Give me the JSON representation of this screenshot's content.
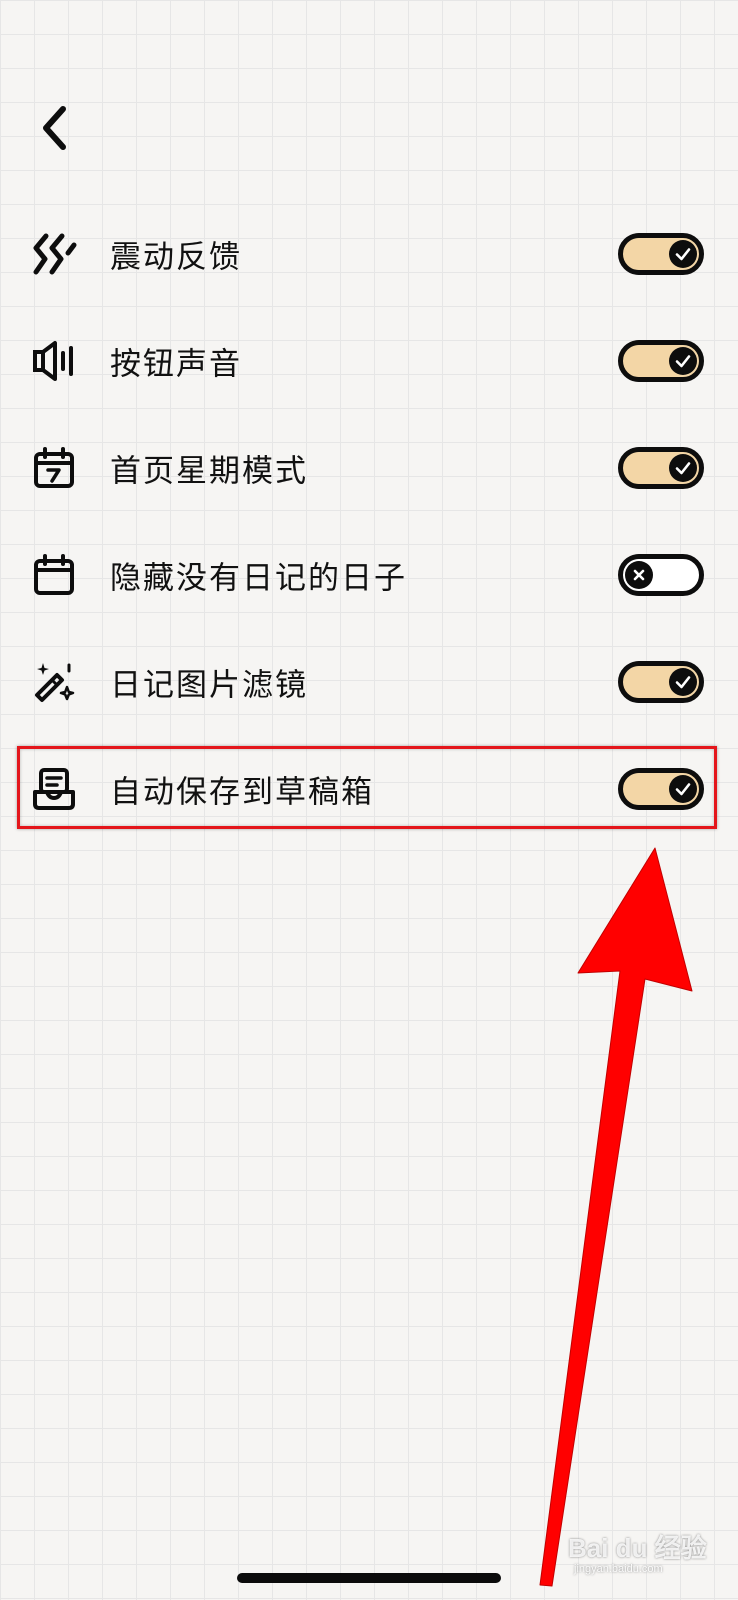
{
  "settings": [
    {
      "label": "震动反馈",
      "icon": "vibration-icon",
      "enabled": true
    },
    {
      "label": "按钮声音",
      "icon": "speaker-icon",
      "enabled": true
    },
    {
      "label": "首页星期模式",
      "icon": "calendar-week-icon",
      "enabled": true
    },
    {
      "label": "隐藏没有日记的日子",
      "icon": "calendar-icon",
      "enabled": false
    },
    {
      "label": "日记图片滤镜",
      "icon": "magic-wand-icon",
      "enabled": true
    },
    {
      "label": "自动保存到草稿箱",
      "icon": "drafts-inbox-icon",
      "enabled": true
    }
  ],
  "annotation": {
    "highlight_color": "#e4161b",
    "arrow_color": "#ff0000"
  },
  "watermark": {
    "brand": "Bai du 经验",
    "url": "jingyan.baidu.com"
  },
  "colors": {
    "toggle_on": "#f3d6a6",
    "toggle_off": "#ffffff",
    "outline": "#0d0d0d"
  }
}
